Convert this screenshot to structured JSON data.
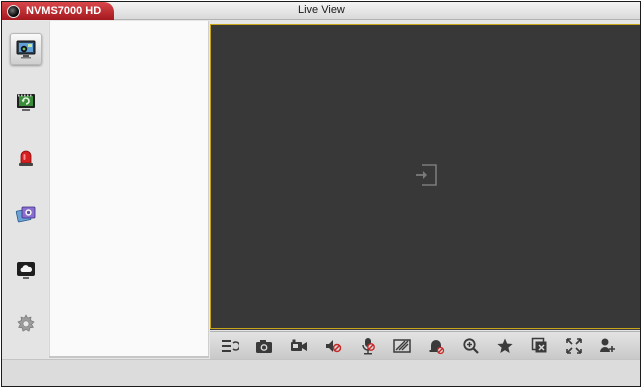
{
  "app": {
    "name": "NVMS7000 HD",
    "window_title": "Live View"
  },
  "sidebar": {
    "items": [
      {
        "name": "live-view",
        "icon": "camera-monitor-icon",
        "active": true
      },
      {
        "name": "playback",
        "icon": "playback-monitor-icon",
        "active": false
      },
      {
        "name": "alarm",
        "icon": "alarm-siren-icon",
        "active": false
      },
      {
        "name": "local-files",
        "icon": "pictures-icon",
        "active": false
      },
      {
        "name": "cloud",
        "icon": "cloud-monitor-icon",
        "active": false
      },
      {
        "name": "settings",
        "icon": "gear-icon",
        "active": false
      }
    ]
  },
  "video": {
    "pane_icon": "add-channel-icon",
    "border_color": "#c9a619"
  },
  "toolbar": {
    "buttons": [
      "live-list-icon",
      "snapshot-icon",
      "record-icon",
      "audio-mute-icon",
      "two-way-audio-icon",
      "image-quality-icon",
      "alarm-output-icon",
      "digital-zoom-icon",
      "favorites-icon",
      "stop-all-icon",
      "fullscreen-icon",
      "ptz-icon"
    ]
  },
  "colors": {
    "brand_red": "#b8252a",
    "video_bg": "#383838",
    "pane_border": "#c9a619"
  }
}
